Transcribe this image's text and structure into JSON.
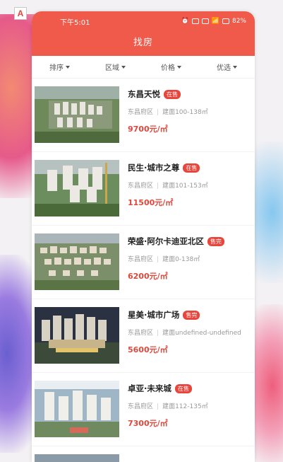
{
  "app_badge": "A",
  "status_bar": {
    "time": "下午5:01",
    "battery": "82%"
  },
  "header": {
    "title": "找房"
  },
  "filters": [
    {
      "label": "排序"
    },
    {
      "label": "区域"
    },
    {
      "label": "价格"
    },
    {
      "label": "优选"
    }
  ],
  "listings": [
    {
      "name": "东昌天悦",
      "tag": "在售",
      "district": "东昌府区",
      "area": "建面100-138㎡",
      "price": "9700元/㎡"
    },
    {
      "name": "民生·城市之尊",
      "tag": "在售",
      "district": "东昌府区",
      "area": "建面101-153㎡",
      "price": "11500元/㎡"
    },
    {
      "name": "荣盛·阿尔卡迪亚北区",
      "tag": "售完",
      "district": "东昌府区",
      "area": "建面0-138㎡",
      "price": "6200元/㎡"
    },
    {
      "name": "星美·城市广场",
      "tag": "售完",
      "district": "东昌府区",
      "area": "建面undefined-undefined",
      "price": "5600元/㎡"
    },
    {
      "name": "卓亚·未来城",
      "tag": "在售",
      "district": "东昌府区",
      "area": "建面112-135㎡",
      "price": "7300元/㎡"
    }
  ],
  "colors": {
    "brand": "#f05a4a",
    "tag": "#e8463c",
    "price": "#e0473c"
  }
}
